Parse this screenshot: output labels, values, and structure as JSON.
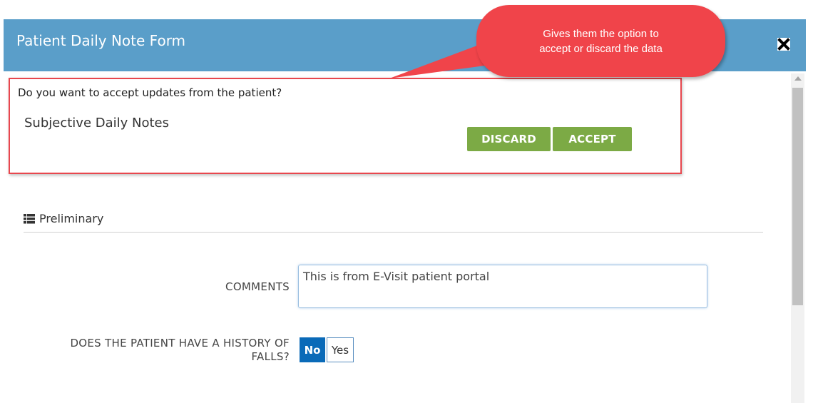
{
  "modal": {
    "title": "Patient Daily Note Form",
    "close_icon": "close-x-icon"
  },
  "accept_panel": {
    "question": "Do you want to accept updates from the patient?",
    "section_label": "Subjective Daily Notes",
    "discard_label": "DISCARD",
    "accept_label": "ACCEPT"
  },
  "callout": {
    "text_line1": "Gives them the option to",
    "text_line2": "accept or discard the data",
    "color": "#f0444a"
  },
  "preliminary": {
    "heading": "Preliminary",
    "icon": "list-icon",
    "comments_label": "COMMENTS",
    "comments_value": "This is from E-Visit patient portal",
    "falls_label_line1": "DOES THE PATIENT HAVE A HISTORY OF",
    "falls_label_line2": "FALLS?",
    "falls_no": "No",
    "falls_yes": "Yes",
    "falls_selected": "No"
  },
  "colors": {
    "header": "#5a9ec9",
    "button_green": "#7caa45",
    "toggle_selected": "#0a6ab8",
    "highlight_border": "#e8474e"
  }
}
